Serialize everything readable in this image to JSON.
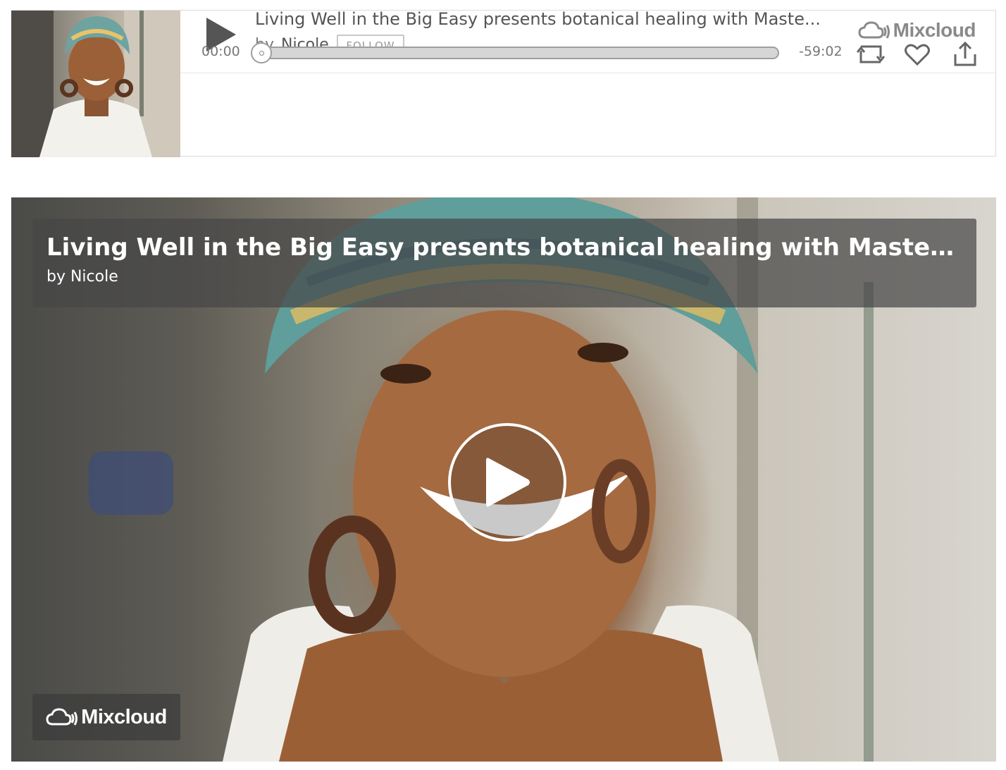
{
  "mini_player": {
    "title": "Living Well in the Big Easy presents botanical healing with Maste...",
    "by_label": "by",
    "author": "Nicole",
    "follow_label": "FOLLOW",
    "brand": "Mixcloud",
    "current_time": "00:00",
    "remaining_time": "-59:02",
    "progress": 0,
    "icons": {
      "play": "play-icon",
      "repost": "repost-icon",
      "favorite": "heart-icon",
      "share": "share-icon",
      "brand": "mixcloud-cloud-icon"
    }
  },
  "big_player": {
    "title": "Living Well in the Big Easy presents botanical healing with Master Her...",
    "byline": "by Nicole",
    "brand": "Mixcloud",
    "icons": {
      "play": "play-circle-icon",
      "brand": "mixcloud-cloud-icon"
    }
  },
  "colors": {
    "text_dark": "#555555",
    "text_muted": "#777777",
    "border": "#dcdcdc",
    "overlay": "#464646"
  }
}
